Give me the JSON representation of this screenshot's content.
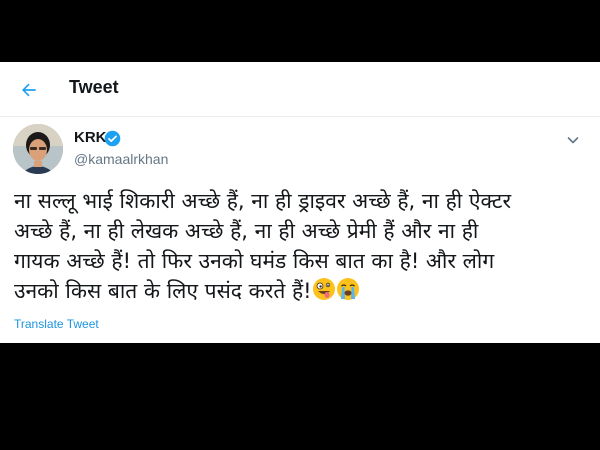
{
  "header": {
    "back_icon": "back-arrow-icon",
    "title": "Tweet"
  },
  "author": {
    "name": "KRK",
    "verified_icon": "verified-badge-icon",
    "handle": "@kamaalrkhan",
    "menu_icon": "chevron-down-icon"
  },
  "tweet": {
    "text": "ना सल्लू भाई शिकारी अच्छे हैं, ना ही ड्राइवर अच्छे हैं, ना ही ऐक्टर\nअच्छे हैं, ना ही लेखक अच्छे हैं, ना ही  अच्छे प्रेमी हैं और ना ही\nगायक अच्छे हैं! तो फिर उनको घमंड किस बात का है! और लोग\nउनको किस बात के लिए पसंद करते हैं!",
    "emojis": [
      "zany-face-emoji",
      "crying-face-emoji"
    ],
    "translate_label": "Translate Tweet"
  },
  "colors": {
    "accent": "#1da1f2",
    "link": "#1b95e0",
    "text": "#14171a",
    "muted": "#657786",
    "background": "#000000"
  }
}
